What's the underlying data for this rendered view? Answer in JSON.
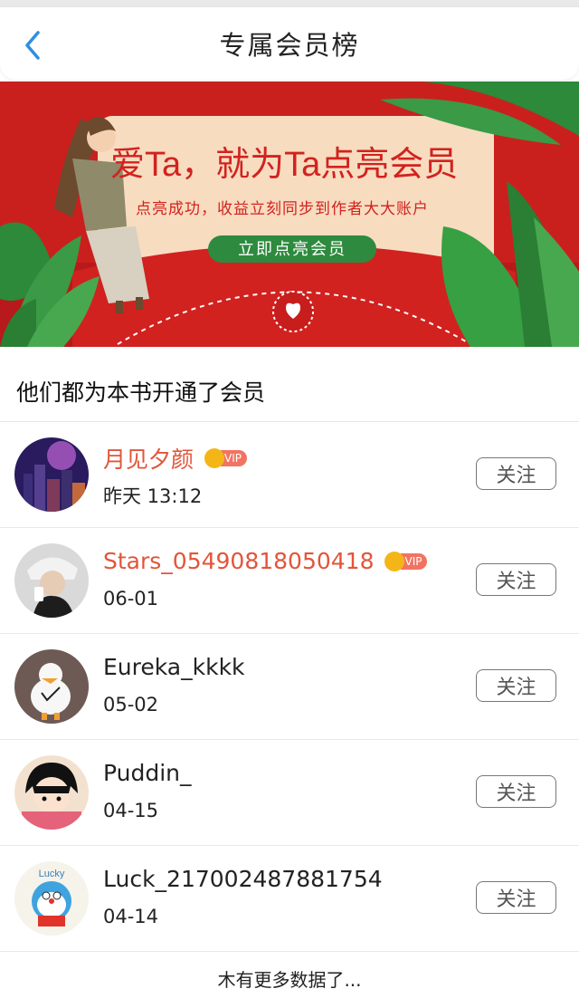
{
  "header": {
    "title": "专属会员榜"
  },
  "banner": {
    "headline": "爱Ta，就为Ta点亮会员",
    "subline": "点亮成功，收益立刻同步到作者大大账户",
    "cta_label": "立即点亮会员"
  },
  "section_title": "他们都为本书开通了会员",
  "members": [
    {
      "name": "月见夕颜",
      "date": "昨天 13:12",
      "vip": true,
      "vip_label": "VIP",
      "follow_label": "关注"
    },
    {
      "name": "Stars_05490818050418",
      "date": "06-01",
      "vip": true,
      "vip_label": "VIP",
      "follow_label": "关注"
    },
    {
      "name": "Eureka_kkkk",
      "date": "05-02",
      "vip": false,
      "follow_label": "关注"
    },
    {
      "name": "Puddin_",
      "date": "04-15",
      "vip": false,
      "follow_label": "关注"
    },
    {
      "name": "Luck_217002487881754",
      "date": "04-14",
      "vip": false,
      "follow_label": "关注"
    }
  ],
  "footer": "木有更多数据了...",
  "colors": {
    "accent_blue": "#2f8ee0",
    "vip_name": "#e2553a",
    "banner_red": "#c9201e",
    "banner_card": "#f7dcc0",
    "cta_green": "#2e8a3e"
  },
  "avatar_label": "Lucky"
}
